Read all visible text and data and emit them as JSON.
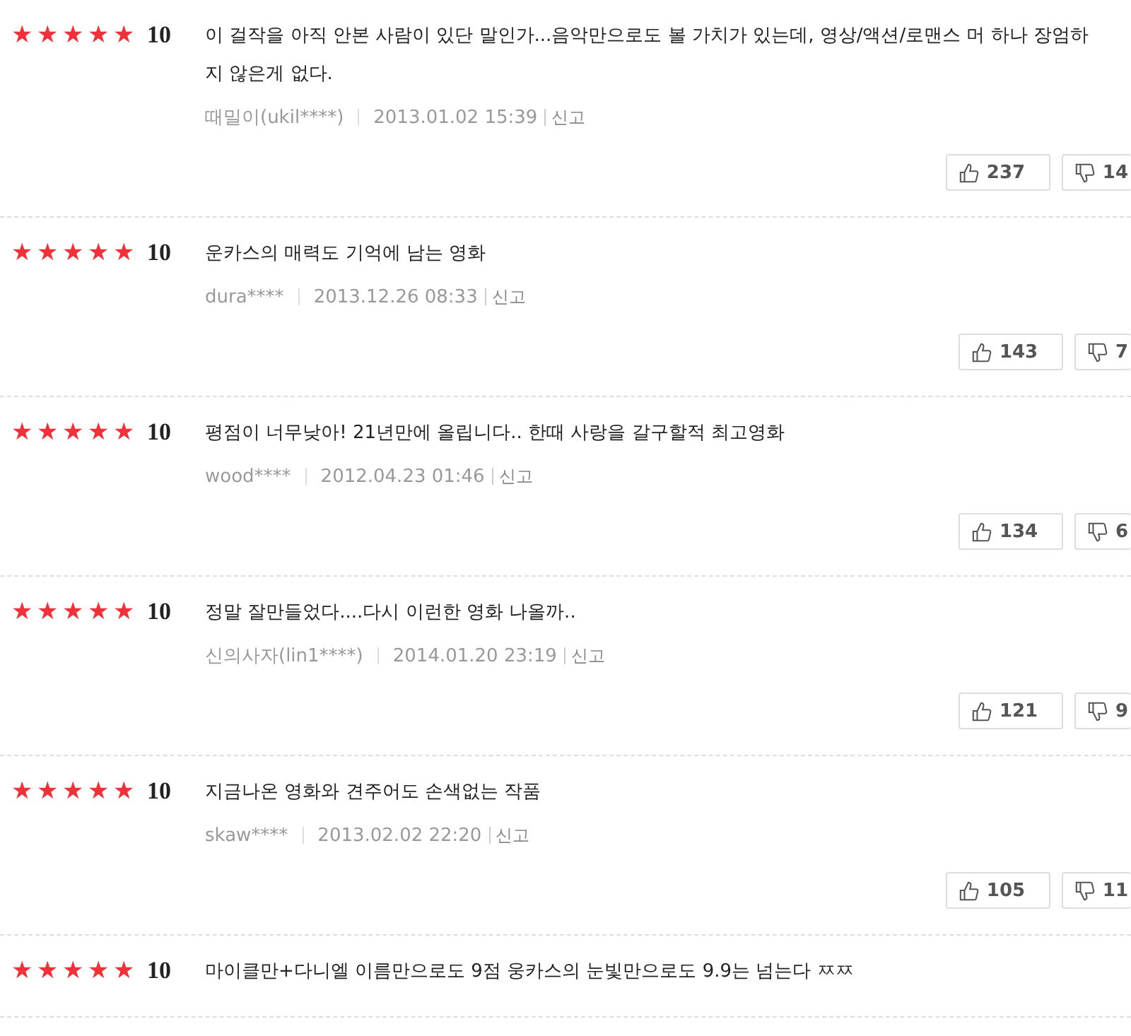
{
  "reviews": [
    {
      "stars": 5,
      "score": "10",
      "text": "이 걸작을 아직 안본 사람이 있단 말인가...음악만으로도 볼 가치가 있는데, 영상/액션/로맨스 머 하나 장엄하지 않은게 없다.",
      "author": "때밀이(ukil****)",
      "date": "2013.01.02 15:39",
      "report": "신고",
      "likes": "237",
      "dislikes": "14"
    },
    {
      "stars": 5,
      "score": "10",
      "text": "운카스의 매력도 기억에 남는 영화",
      "author": "dura****",
      "date": "2013.12.26 08:33",
      "report": "신고",
      "likes": "143",
      "dislikes": "7"
    },
    {
      "stars": 5,
      "score": "10",
      "text": "평점이 너무낮아! 21년만에 올립니다.. 한때 사랑을 갈구할적 최고영화",
      "author": "wood****",
      "date": "2012.04.23 01:46",
      "report": "신고",
      "likes": "134",
      "dislikes": "6"
    },
    {
      "stars": 5,
      "score": "10",
      "text": "정말 잘만들었다....다시 이런한 영화 나올까..",
      "author": "신의사자(lin1****)",
      "date": "2014.01.20 23:19",
      "report": "신고",
      "likes": "121",
      "dislikes": "9"
    },
    {
      "stars": 5,
      "score": "10",
      "text": "지금나온 영화와 견주어도 손색없는 작품",
      "author": "skaw****",
      "date": "2013.02.02 22:20",
      "report": "신고",
      "likes": "105",
      "dislikes": "11"
    },
    {
      "stars": 5,
      "score": "10",
      "text": "마이클만+다니엘 이름만으로도 9점 웅카스의 눈빛만으로도 9.9는 넘는다 ㅉㅉ"
    }
  ]
}
